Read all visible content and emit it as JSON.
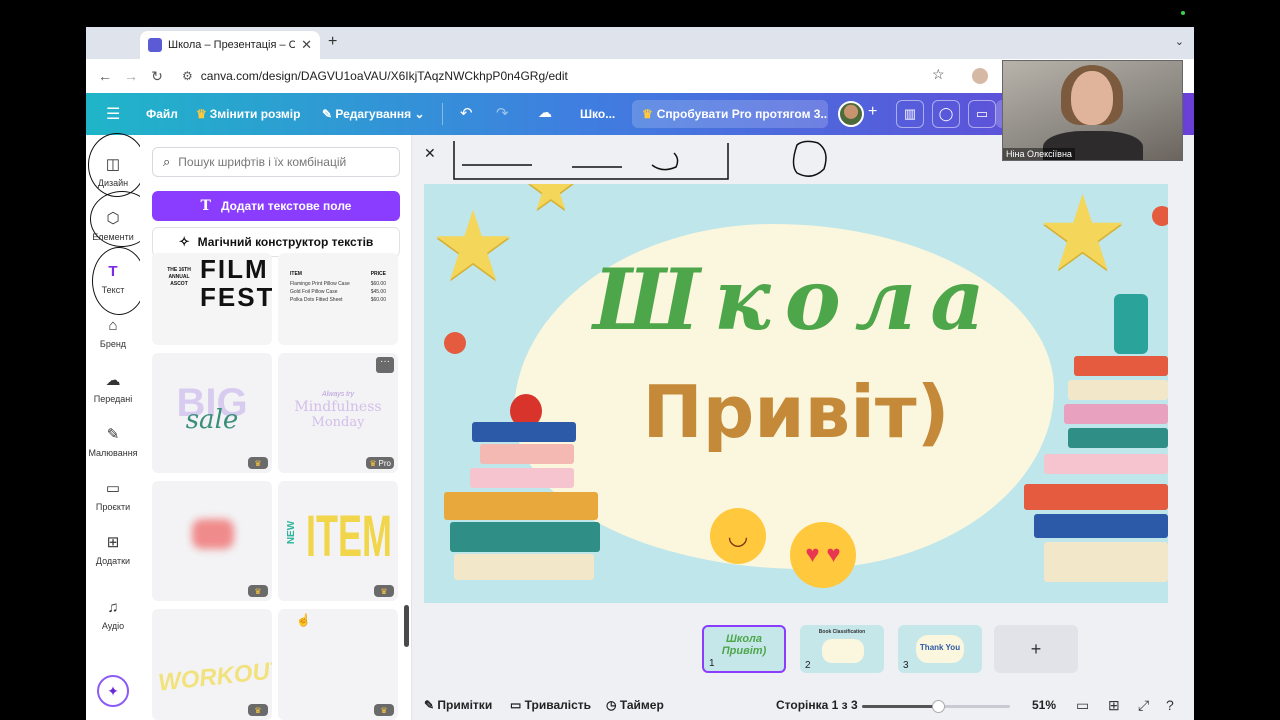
{
  "browser": {
    "tab_title": "Школа – Презентація – Canva",
    "url": "canva.com/design/DAGVU1oaVAU/X6IkjTAqzNWCkhpP0n4GRg/edit"
  },
  "header": {
    "file": "Файл",
    "resize": "Змінити розмір",
    "editing": "Редагування",
    "doc_title": "Шко...",
    "try_pro": "Спробувати Pro протягом 3..."
  },
  "rail": [
    {
      "label": "Дизайн",
      "icon": "design-icon",
      "glyph": "◫"
    },
    {
      "label": "Елементи",
      "icon": "elements-icon",
      "glyph": "⬡"
    },
    {
      "label": "Текст",
      "icon": "text-icon",
      "glyph": "T"
    },
    {
      "label": "Бренд",
      "icon": "brand-icon",
      "glyph": "⌂"
    },
    {
      "label": "Передані",
      "icon": "uploads-icon",
      "glyph": "☁"
    },
    {
      "label": "Малювання",
      "icon": "draw-icon",
      "glyph": "✎"
    },
    {
      "label": "Проєкти",
      "icon": "projects-icon",
      "glyph": "▭"
    },
    {
      "label": "Додатки",
      "icon": "apps-icon",
      "glyph": "⊞"
    },
    {
      "label": "Аудіо",
      "icon": "audio-icon",
      "glyph": "♫"
    }
  ],
  "panel": {
    "search_placeholder": "Пошук шрифтів і їх комбінацій",
    "add_text_button": "Додати текстове поле",
    "magic_text_button": "Магічний конструктор текстів",
    "tiles": {
      "film_small": "THE 16TH ANNUAL ASCOT",
      "film_big": "FILM FEST",
      "price_head_item": "ITEM",
      "price_head_price": "PRICE",
      "price_rows": [
        [
          "Flamingo Print Pillow Case",
          "$60.00"
        ],
        [
          "Gold Foil Pillow Case",
          "$45.00"
        ],
        [
          "Polka Dots Fitted Sheet",
          "$60.00"
        ]
      ],
      "big_sale_1": "BIG",
      "big_sale_2": "sale",
      "mindful_small": "Always try",
      "mindful_1": "Mindfulness",
      "mindful_2": "Monday",
      "new": "NEW",
      "item": "ITEM",
      "workout": "WORKOUT",
      "pro_badge": "Pro"
    }
  },
  "slide": {
    "title": "Школа",
    "subtitle": "Привіт)"
  },
  "thumbnails": [
    {
      "num": "1",
      "text": "Школа Привіт)"
    },
    {
      "num": "2",
      "text": "Book Classification"
    },
    {
      "num": "3",
      "text": "Thank You"
    }
  ],
  "bottom": {
    "notes": "Примітки",
    "duration": "Тривалість",
    "timer": "Таймер",
    "page": "Сторінка 1 з 3",
    "zoom_value": 51,
    "zoom": "51%"
  },
  "webcam": {
    "name": "Ніна Олексіївна"
  },
  "colors": {
    "accent": "#8b3dff",
    "title_green": "#4ea64b",
    "subtitle_brown": "#c48a3a"
  }
}
